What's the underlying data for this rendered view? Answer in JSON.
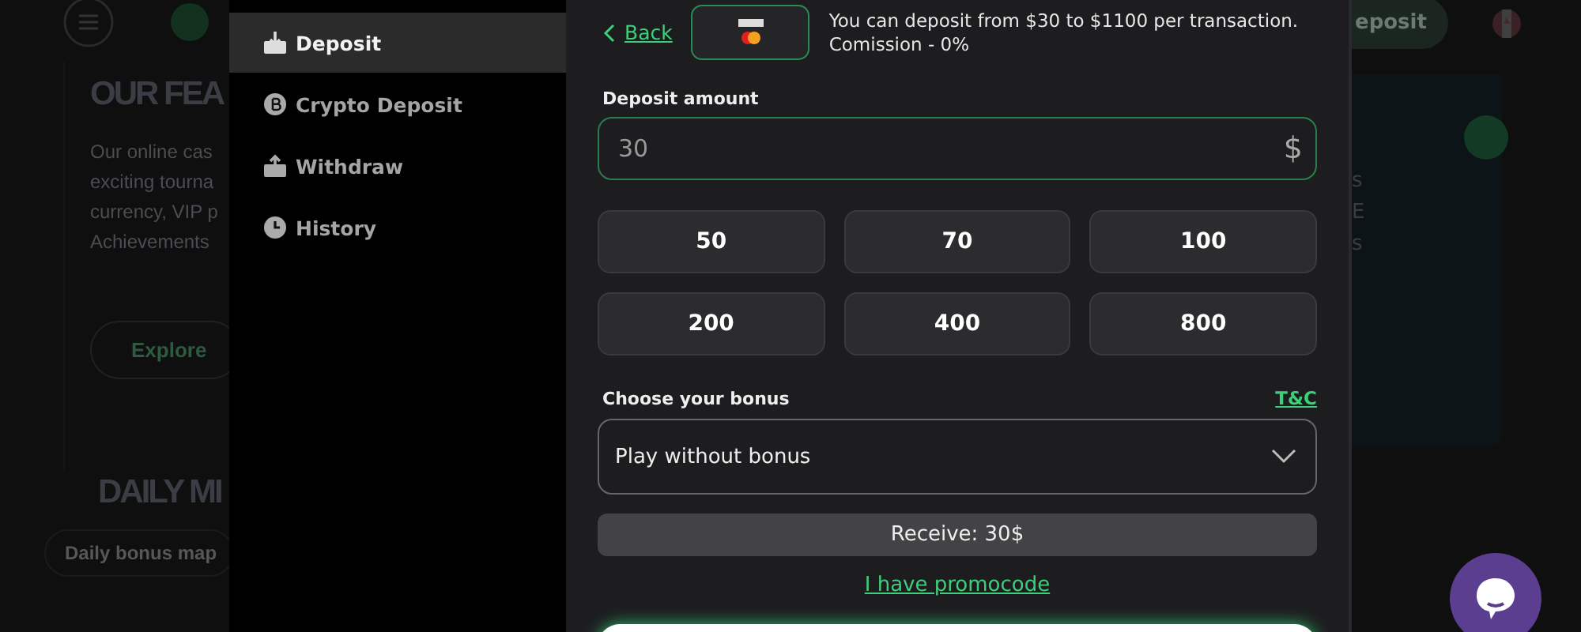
{
  "background_page": {
    "header_button": "eposit",
    "heading": "OUR FEA",
    "text_lines": [
      "Our online cas",
      "exciting tourna",
      "currency, VIP p",
      "Achievements"
    ],
    "explore_button": "Explore",
    "section_heading": "DAILY MI",
    "chip": "Daily bonus map",
    "right_letters": [
      "s",
      "E",
      "s"
    ]
  },
  "sidebar": {
    "items": [
      {
        "label": "Deposit",
        "selected": true
      },
      {
        "label": "Crypto Deposit",
        "selected": false
      },
      {
        "label": "Withdraw",
        "selected": false
      },
      {
        "label": "History",
        "selected": false
      }
    ]
  },
  "deposit": {
    "back": "Back",
    "limits": "You can deposit from $30 to $1100 per transaction.",
    "commission": "Comission - 0%",
    "amount_label": "Deposit amount",
    "amount": "30",
    "currency": "$",
    "presets": [
      {
        "label": "50",
        "selected": false
      },
      {
        "label": "70",
        "selected": false
      },
      {
        "label": "100",
        "selected": false
      },
      {
        "label": "200",
        "selected": false
      },
      {
        "label": "400",
        "selected": false
      },
      {
        "label": "800",
        "selected": false
      }
    ],
    "bonus_label": "Choose your bonus",
    "terms_link": "T&C",
    "bonus_value": "Play without bonus",
    "receive": "Receive: 30$",
    "promocode_link": "I have promocode"
  }
}
